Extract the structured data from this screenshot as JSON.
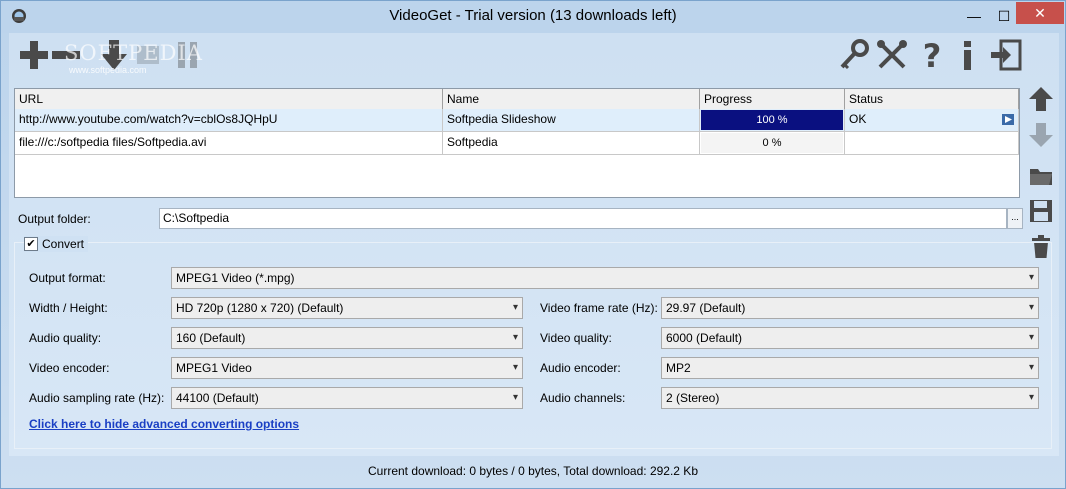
{
  "window": {
    "title": "VideoGet - Trial version (13 downloads left)",
    "min_glyph": "—",
    "max_glyph": "☐",
    "close_glyph": "✕"
  },
  "toolbar": {
    "watermark_main": "SOFTPEDIA",
    "watermark_sub": "www.softpedia.com",
    "left_icons": [
      "add-icon",
      "remove-icon",
      "download-icon",
      "pause-icon"
    ],
    "right_icons": [
      "key-icon",
      "tools-icon",
      "help-icon",
      "info-icon",
      "exit-icon"
    ]
  },
  "grid": {
    "columns": [
      "URL",
      "Name",
      "Progress",
      "Status"
    ],
    "rows": [
      {
        "url": "http://www.youtube.com/watch?v=cblOs8JQHpU",
        "name": "Softpedia Slideshow",
        "progress_text": "100 %",
        "progress": 1.0,
        "status": "OK"
      },
      {
        "url": "file:///c:/softpedia files/Softpedia.avi",
        "name": "Softpedia",
        "progress_text": "0 %",
        "progress": 0.0,
        "status": ""
      }
    ]
  },
  "output": {
    "label": "Output folder:",
    "value": "C:\\Softpedia",
    "browse_label": "..."
  },
  "convert": {
    "label": "Convert",
    "checked_glyph": "✔",
    "output_format_label": "Output format:",
    "output_format_value": "MPEG1 Video (*.mpg)",
    "width_height_label": "Width / Height:",
    "width_height_value": "HD 720p (1280 x 720) (Default)",
    "audio_quality_label": "Audio quality:",
    "audio_quality_value": "160 (Default)",
    "video_encoder_label": "Video encoder:",
    "video_encoder_value": "MPEG1 Video",
    "audio_sampling_label": "Audio sampling rate (Hz):",
    "audio_sampling_value": "44100 (Default)",
    "frame_rate_label": "Video frame rate (Hz):",
    "frame_rate_value": "29.97 (Default)",
    "video_quality_label": "Video quality:",
    "video_quality_value": "6000 (Default)",
    "audio_encoder_label": "Audio encoder:",
    "audio_encoder_value": "MP2",
    "audio_channels_label": "Audio channels:",
    "audio_channels_value": "2 (Stereo)",
    "dropdown_glyph": "▾",
    "hide_link": "Click here to hide advanced converting options"
  },
  "status": {
    "text": "Current download: 0 bytes / 0 bytes,  Total download: 292.2 Kb"
  },
  "colors": {
    "progress_fill": "#0a1080",
    "link": "#1a3fc4",
    "close_button": "#c7504b"
  }
}
